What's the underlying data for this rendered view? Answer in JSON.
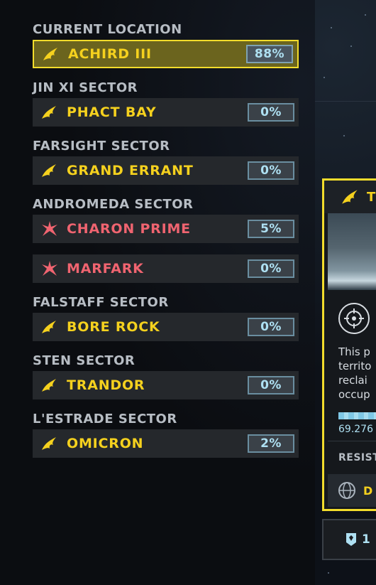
{
  "current_location": {
    "title": "CURRENT LOCATION",
    "planet": {
      "name": "ACHIRD III",
      "liberation": "88%",
      "faction": "super-earth",
      "icon": "super-earth-emblem-icon"
    }
  },
  "sectors": [
    {
      "title": "JIN XI SECTOR",
      "planets": [
        {
          "name": "PHACT BAY",
          "liberation": "0%",
          "faction": "super-earth"
        }
      ]
    },
    {
      "title": "FARSIGHT SECTOR",
      "planets": [
        {
          "name": "GRAND ERRANT",
          "liberation": "0%",
          "faction": "super-earth"
        }
      ]
    },
    {
      "title": "ANDROMEDA SECTOR",
      "planets": [
        {
          "name": "CHARON PRIME",
          "liberation": "5%",
          "faction": "automaton"
        },
        {
          "name": "MARFARK",
          "liberation": "0%",
          "faction": "automaton"
        }
      ]
    },
    {
      "title": "FALSTAFF SECTOR",
      "planets": [
        {
          "name": "BORE ROCK",
          "liberation": "0%",
          "faction": "super-earth"
        }
      ]
    },
    {
      "title": "STEN SECTOR",
      "planets": [
        {
          "name": "TRANDOR",
          "liberation": "0%",
          "faction": "super-earth"
        }
      ]
    },
    {
      "title": "L'ESTRADE SECTOR",
      "planets": [
        {
          "name": "OMICRON",
          "liberation": "2%",
          "faction": "super-earth"
        }
      ]
    }
  ],
  "detail_panel": {
    "header_text": "T",
    "description": "This p\nterrito\nreclai\noccup",
    "progress_value": "69.276",
    "resist_label": "RESIST",
    "footer_text": "D",
    "icons": {
      "header": "super-earth-emblem-icon",
      "target": "crosshair-target-icon",
      "footer": "globe-emblem-icon"
    }
  },
  "medals": {
    "count": "1",
    "icon": "medal-icon"
  },
  "colors": {
    "accent_yellow": "#f2dc2c",
    "human_text": "#f5d11e",
    "enemy_text": "#f06470",
    "percent_text": "#aee0f2",
    "percent_border": "#6a8ea0",
    "row_bg": "#25282c",
    "selected_bg": "#6b641e"
  }
}
